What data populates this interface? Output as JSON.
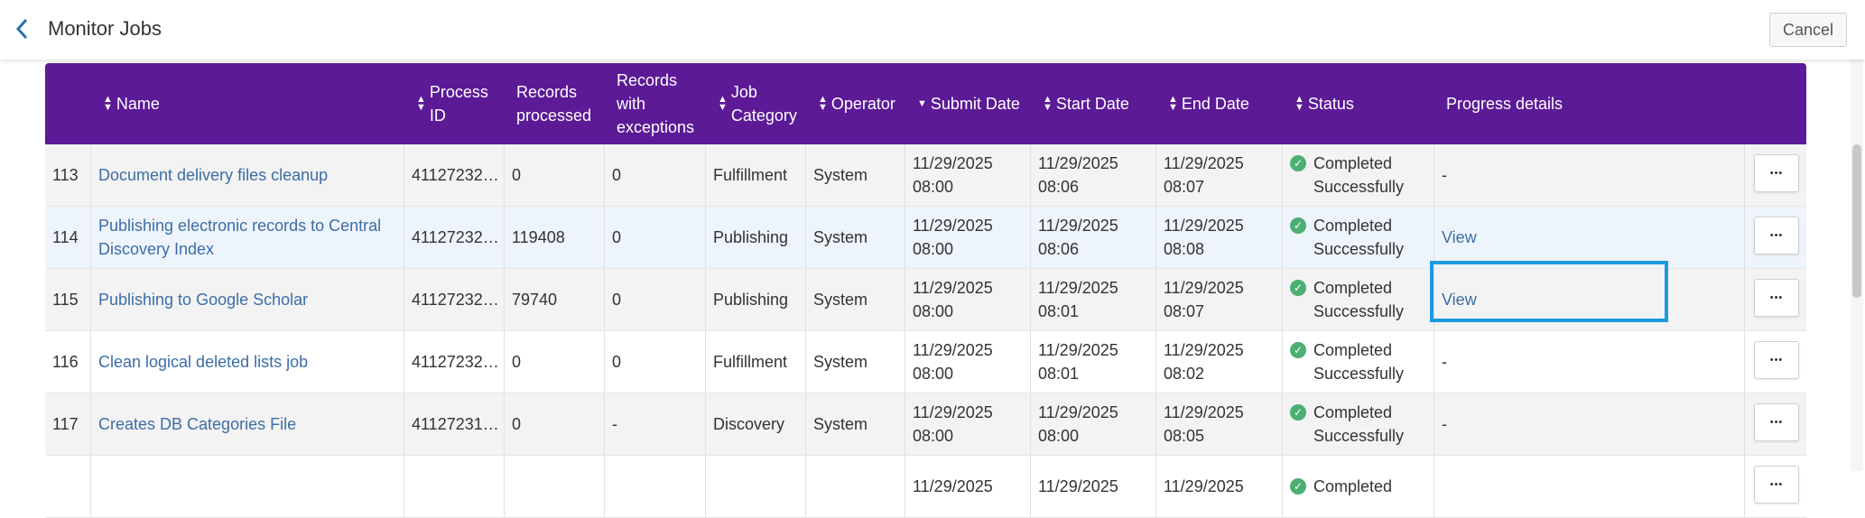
{
  "header": {
    "title": "Monitor Jobs",
    "cancel_label": "Cancel"
  },
  "columns": [
    {
      "label": "Name",
      "sortable": true
    },
    {
      "label": "Process ID",
      "sortable": true
    },
    {
      "label": "Records processed",
      "sortable": false
    },
    {
      "label": "Records with exceptions",
      "sortable": false
    },
    {
      "label": "Job Category",
      "sortable": true
    },
    {
      "label": "Operator",
      "sortable": true
    },
    {
      "label": "Submit Date",
      "sortable": true,
      "sorted": "desc"
    },
    {
      "label": "Start Date",
      "sortable": true
    },
    {
      "label": "End Date",
      "sortable": true
    },
    {
      "label": "Status",
      "sortable": true
    },
    {
      "label": "Progress details",
      "sortable": false
    }
  ],
  "rows": [
    {
      "num": "113",
      "name": "Document delivery files cleanup",
      "pid": "41127232…",
      "processed": "0",
      "exceptions": "0",
      "category": "Fulfillment",
      "operator": "System",
      "submit": [
        "11/29/2025",
        "08:00"
      ],
      "start": [
        "11/29/2025",
        "08:06"
      ],
      "end": [
        "11/29/2025",
        "08:07"
      ],
      "status": [
        "Completed",
        "Successfully"
      ],
      "progress": "-",
      "progress_link": false
    },
    {
      "num": "114",
      "name": "Publishing electronic records to Central Discovery Index",
      "pid": "41127232…",
      "processed": "119408",
      "exceptions": "0",
      "category": "Publishing",
      "operator": "System",
      "submit": [
        "11/29/2025",
        "08:00"
      ],
      "start": [
        "11/29/2025",
        "08:06"
      ],
      "end": [
        "11/29/2025",
        "08:08"
      ],
      "status": [
        "Completed",
        "Successfully"
      ],
      "progress": "View",
      "progress_link": true
    },
    {
      "num": "115",
      "name": "Publishing to Google Scholar",
      "pid": "41127232…",
      "processed": "79740",
      "exceptions": "0",
      "category": "Publishing",
      "operator": "System",
      "submit": [
        "11/29/2025",
        "08:00"
      ],
      "start": [
        "11/29/2025",
        "08:01"
      ],
      "end": [
        "11/29/2025",
        "08:07"
      ],
      "status": [
        "Completed",
        "Successfully"
      ],
      "progress": "View",
      "progress_link": true
    },
    {
      "num": "116",
      "name": "Clean logical deleted lists job",
      "pid": "41127232…",
      "processed": "0",
      "exceptions": "0",
      "category": "Fulfillment",
      "operator": "System",
      "submit": [
        "11/29/2025",
        "08:00"
      ],
      "start": [
        "11/29/2025",
        "08:01"
      ],
      "end": [
        "11/29/2025",
        "08:02"
      ],
      "status": [
        "Completed",
        "Successfully"
      ],
      "progress": "-",
      "progress_link": false
    },
    {
      "num": "117",
      "name": "Creates DB Categories File",
      "pid": "41127231…",
      "processed": "0",
      "exceptions": "-",
      "category": "Discovery",
      "operator": "System",
      "submit": [
        "11/29/2025",
        "08:00"
      ],
      "start": [
        "11/29/2025",
        "08:00"
      ],
      "end": [
        "11/29/2025",
        "08:05"
      ],
      "status": [
        "Completed",
        "Successfully"
      ],
      "progress": "-",
      "progress_link": false
    },
    {
      "num": "",
      "name": "",
      "pid": "",
      "processed": "",
      "exceptions": "",
      "category": "",
      "operator": "",
      "submit": [
        "11/29/2025",
        ""
      ],
      "start": [
        "11/29/2025",
        ""
      ],
      "end": [
        "11/29/2025",
        ""
      ],
      "status": [
        "Completed",
        ""
      ],
      "progress": "",
      "progress_link": false
    }
  ],
  "icons": {
    "back": "chevron-left-icon",
    "status": "check-circle-icon",
    "more": "ellipsis-icon"
  },
  "colors": {
    "header_bg": "#5c1a96",
    "link": "#3c6da6",
    "success": "#4caf73",
    "focus": "#1a9be0"
  }
}
